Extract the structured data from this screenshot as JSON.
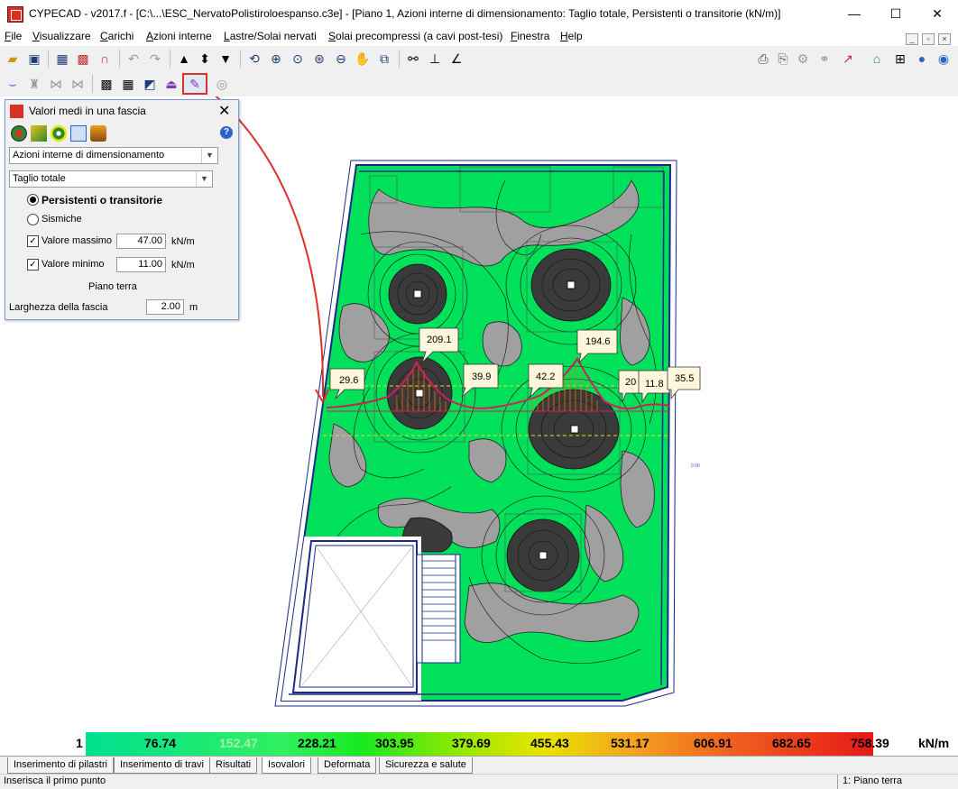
{
  "window": {
    "title": "CYPECAD - v2017.f - [C:\\...\\ESC_NervatoPolistiroloespanso.c3e] - [Piano 1, Azioni interne di dimensionamento: Taglio totale, Persistenti o transitorie (kN/m)]",
    "minimize": "—",
    "maximize": "☐",
    "close": "✕"
  },
  "menu": [
    {
      "label": "File"
    },
    {
      "label": "Visualizzare"
    },
    {
      "label": "Carichi"
    },
    {
      "label": "Azioni interne"
    },
    {
      "label": "Lastre/Solai nervati"
    },
    {
      "label": "Solai precompressi (a cavi post-tesi)"
    },
    {
      "label": "Finestra"
    },
    {
      "label": "Help"
    }
  ],
  "dialog": {
    "title": "Valori medi in una fascia",
    "close": "✕",
    "help": "?",
    "combo1": "Azioni interne di dimensionamento",
    "combo2": "Taglio totale",
    "radio1": "Persistenti o transitorie",
    "radio2": "Sismiche",
    "max_label": "Valore massimo",
    "max_value": "47.00",
    "max_unit": "kN/m",
    "min_label": "Valore minimo",
    "min_value": "11.00",
    "min_unit": "kN/m",
    "floor": "Piano terra",
    "width_label": "Larghezza della fascia",
    "width_value": "2.00",
    "width_unit": "m"
  },
  "drawing": {
    "callouts": [
      "29.6",
      "209.1",
      "39.9",
      "42.2",
      "194.6",
      "20",
      "11.8",
      "35.5"
    ],
    "small_label": "0.00"
  },
  "scale": {
    "values": [
      "1",
      "76.74",
      "152.47",
      "228.21",
      "303.95",
      "379.69",
      "455.43",
      "531.17",
      "606.91",
      "682.65",
      "758.39"
    ],
    "unit": "kN/m"
  },
  "tabs": [
    {
      "label": "Inserimento di pilastri"
    },
    {
      "label": "Inserimento di travi"
    },
    {
      "label": "Risultati"
    },
    {
      "label": "Isovalori"
    },
    {
      "label": "Deformata"
    },
    {
      "label": "Sicurezza e salute"
    }
  ],
  "status": {
    "left": "Inserisca il primo punto",
    "right": "1: Piano terra"
  },
  "colors": {
    "contour_green": "#00e05a",
    "contour_gray": "#a0a0a0",
    "contour_dark": "#3a3a3a",
    "diagram_line": "#d0205a",
    "highlight": "#e0302a"
  }
}
